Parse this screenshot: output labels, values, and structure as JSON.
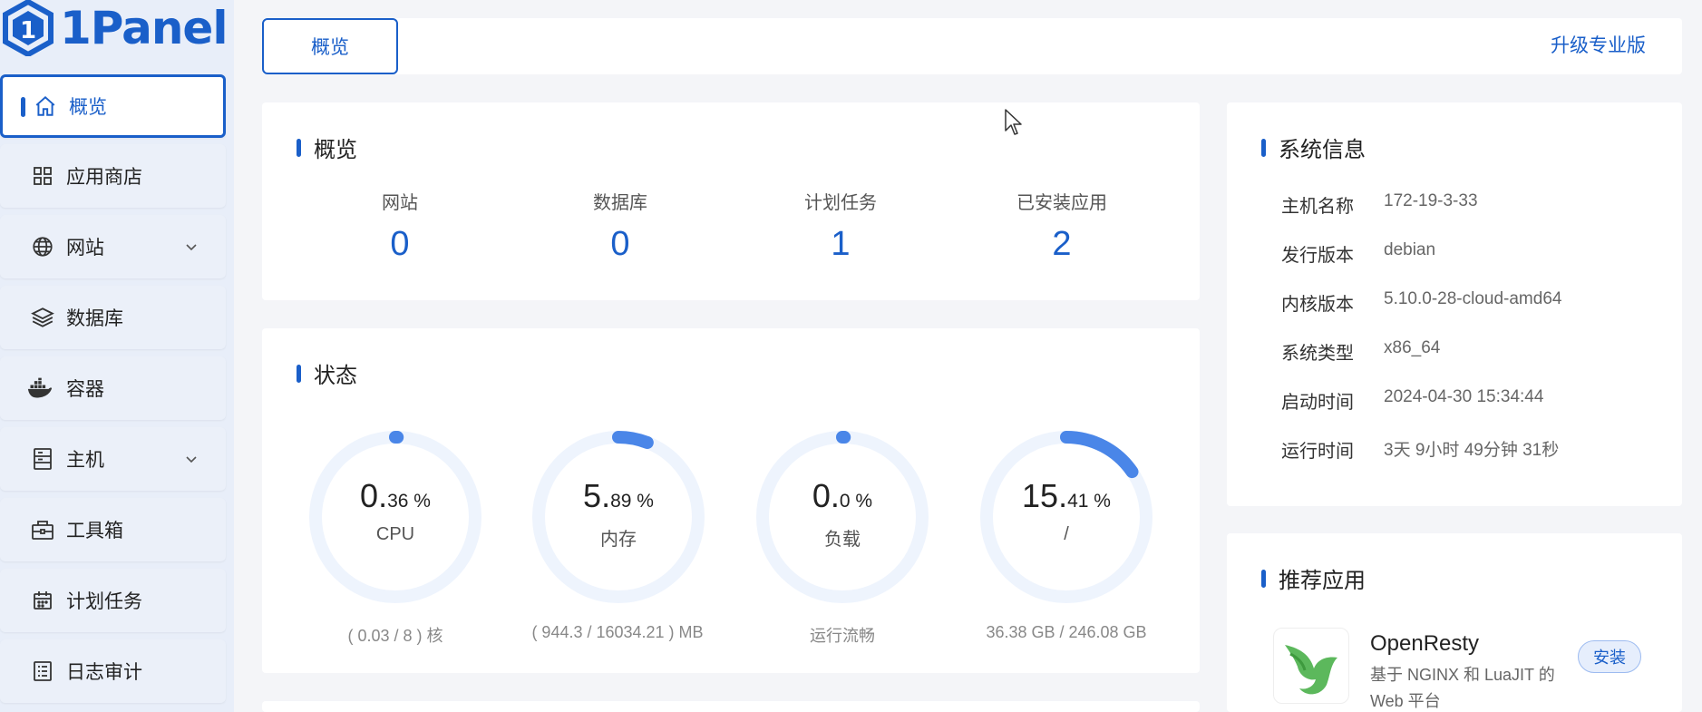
{
  "brand": {
    "name": "1Panel",
    "color": "#1a5fc9"
  },
  "sidebar": {
    "items": [
      {
        "label": "概览",
        "icon": "home-icon",
        "active": true
      },
      {
        "label": "应用商店",
        "icon": "grid-icon"
      },
      {
        "label": "网站",
        "icon": "globe-icon",
        "expandable": true
      },
      {
        "label": "数据库",
        "icon": "layers-icon"
      },
      {
        "label": "容器",
        "icon": "docker-icon"
      },
      {
        "label": "主机",
        "icon": "server-icon",
        "expandable": true
      },
      {
        "label": "工具箱",
        "icon": "toolbox-icon"
      },
      {
        "label": "计划任务",
        "icon": "calendar-icon"
      },
      {
        "label": "日志审计",
        "icon": "log-icon"
      }
    ]
  },
  "topbar": {
    "tab": "概览",
    "upgrade": "升级专业版"
  },
  "overview": {
    "title": "概览",
    "stats": [
      {
        "label": "网站",
        "value": "0"
      },
      {
        "label": "数据库",
        "value": "0"
      },
      {
        "label": "计划任务",
        "value": "1"
      },
      {
        "label": "已安装应用",
        "value": "2"
      }
    ]
  },
  "status": {
    "title": "状态",
    "gauges": [
      {
        "int": "0.",
        "dec": "36 %",
        "percent": 0.36,
        "name": "CPU",
        "detail": "( 0.03 / 8 ) 核"
      },
      {
        "int": "5.",
        "dec": "89 %",
        "percent": 5.89,
        "name": "内存",
        "detail": "( 944.3 / 16034.21 ) MB"
      },
      {
        "int": "0.",
        "dec": "0 %",
        "percent": 0.0,
        "name": "负载",
        "detail": "运行流畅"
      },
      {
        "int": "15.",
        "dec": "41 %",
        "percent": 15.41,
        "name": "/",
        "detail": "36.38 GB / 246.08 GB"
      }
    ]
  },
  "sysinfo": {
    "title": "系统信息",
    "rows": [
      {
        "k": "主机名称",
        "v": "172-19-3-33"
      },
      {
        "k": "发行版本",
        "v": "debian"
      },
      {
        "k": "内核版本",
        "v": "5.10.0-28-cloud-amd64"
      },
      {
        "k": "系统类型",
        "v": "x86_64"
      },
      {
        "k": "启动时间",
        "v": "2024-04-30 15:34:44"
      },
      {
        "k": "运行时间",
        "v": "3天 9小时 49分钟 31秒"
      }
    ]
  },
  "recommend": {
    "title": "推荐应用",
    "app": {
      "name": "OpenResty",
      "desc": "基于 NGINX 和 LuaJIT 的 Web 平台",
      "button": "安装"
    }
  }
}
